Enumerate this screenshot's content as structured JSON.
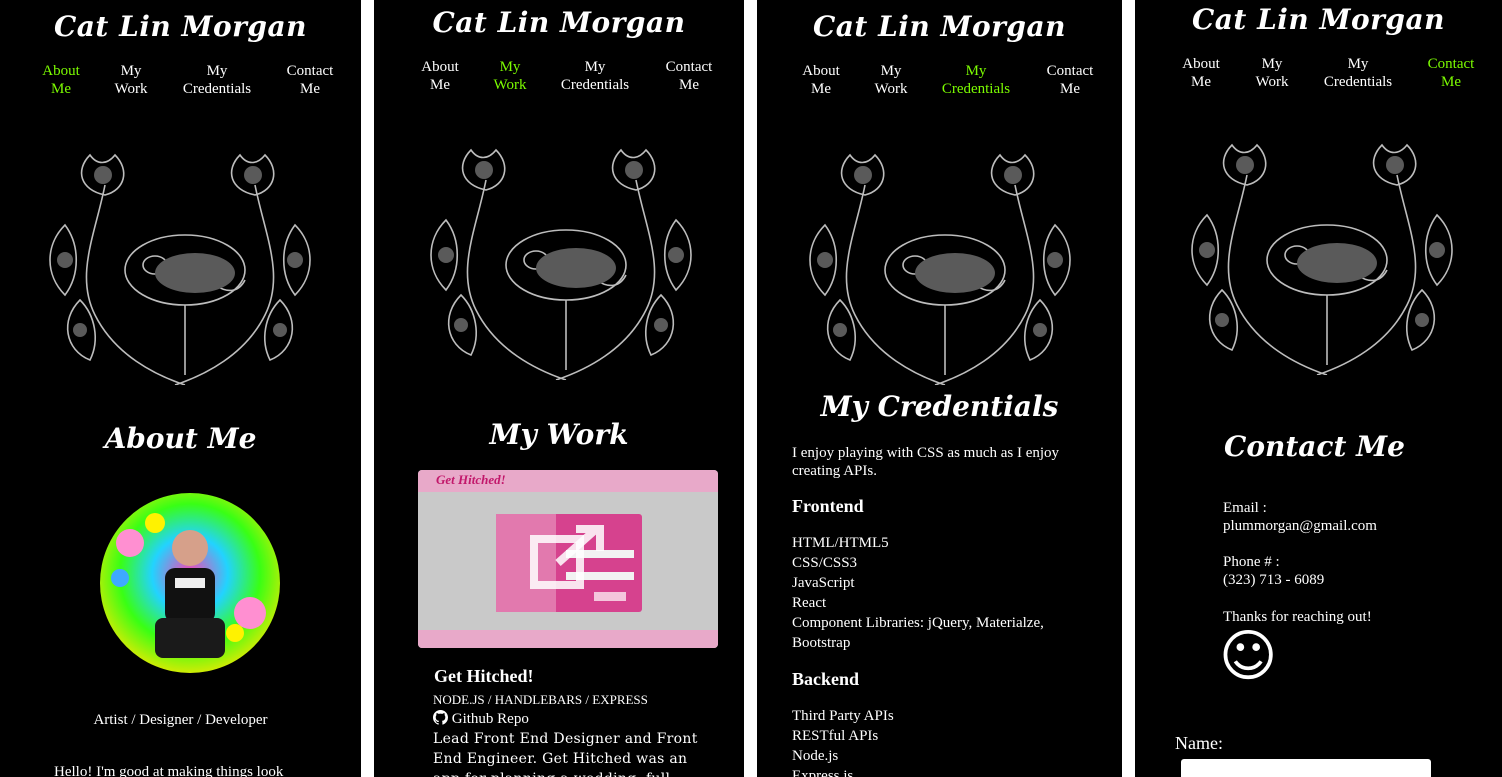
{
  "site_title": "Cat Lin Morgan",
  "nav": {
    "about": "About Me",
    "work": "My Work",
    "credentials": "My Credentials",
    "contact": "Contact Me",
    "about_l1": "About",
    "about_l2": "Me",
    "work_l1": "My",
    "work_l2": "Work",
    "cred_l1": "My",
    "cred_l2": "Credentials",
    "contact_l1": "Contact",
    "contact_l2": "Me"
  },
  "colors": {
    "accent_green": "#7CFC00",
    "background": "#000000",
    "text": "#ffffff"
  },
  "about": {
    "heading": "About Me",
    "tagline": "Artist / Designer / Developer",
    "intro": "Hello! I'm good at making things look"
  },
  "work": {
    "heading": "My Work",
    "project_title": "Get Hitched!",
    "thumb_title": "Get Hitched!",
    "stack": "NODE.JS / HANDLEBARS / EXPRESS",
    "repo_label": "Github Repo",
    "desc_l1": "Lead Front End Designer and Front",
    "desc_l2": "End Engineer. Get Hitched was an",
    "desc_l3": "app for planning a wedding, full"
  },
  "credentials": {
    "heading": "My Credentials",
    "intro_l1": "I enjoy playing with CSS as much as I enjoy",
    "intro_l2": "creating APIs.",
    "frontend_heading": "Frontend",
    "frontend_items": [
      "HTML/HTML5",
      "CSS/CSS3",
      "JavaScript",
      "React",
      "Component Libraries: jQuery, Materialze,",
      "Bootstrap"
    ],
    "backend_heading": "Backend",
    "backend_items": [
      "Third Party APIs",
      "RESTful APIs",
      "Node.js",
      "Express.js"
    ]
  },
  "contact": {
    "heading": "Contact Me",
    "email_label": "Email :",
    "email_value": "plummorgan@gmail.com",
    "phone_label": "Phone # :",
    "phone_value": "(323) 713 - 6089",
    "thanks": "Thanks for reaching out!",
    "smiley": "☺",
    "name_label": "Name:"
  },
  "icons": {
    "art": "floral-skull-illustration-icon",
    "github": "github-icon",
    "external": "external-link-icon",
    "smiley": "smiley-icon"
  }
}
